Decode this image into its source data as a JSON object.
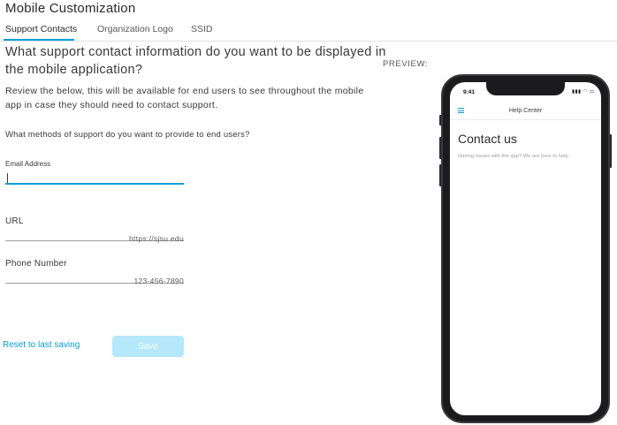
{
  "page_title": "Mobile Customization",
  "tabs": [
    {
      "label": "Support Contacts",
      "active": true
    },
    {
      "label": "Organization Logo",
      "active": false
    },
    {
      "label": "SSID",
      "active": false
    }
  ],
  "headline": "What support contact information do you want to be displayed in the mobile application?",
  "description": "Review the below, this will be available for end users to see throughout the mobile app in case they should need to contact support.",
  "question": "What methods of support do you want to provide to end users?",
  "fields": {
    "email": {
      "label": "Email Address",
      "value": "",
      "helper": ""
    },
    "url": {
      "label": "URL",
      "value": "",
      "helper": "https://sjsu.edu"
    },
    "phone": {
      "label": "Phone Number",
      "value": "",
      "helper": "123-456-7890"
    }
  },
  "actions": {
    "reset_label": "Reset to last saving",
    "save_label": "Save"
  },
  "preview": {
    "label": "PREVIEW:",
    "status_time": "9:41",
    "status_icons": "▮▮▮ ◠ ▭",
    "app_title": "Help Center",
    "heading": "Contact us",
    "subtext": "Having issues with the app? We are here to help."
  },
  "colors": {
    "accent": "#049fd9",
    "save_disabled": "#b4e8fa",
    "text": "#39393b"
  }
}
